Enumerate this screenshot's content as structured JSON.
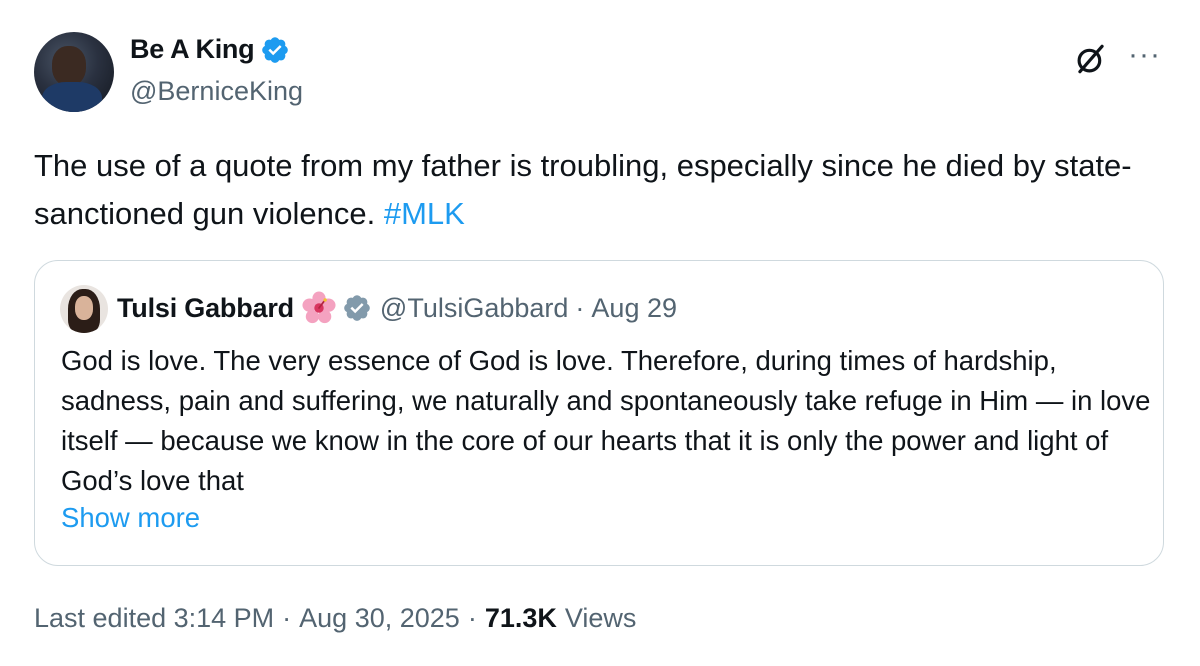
{
  "author": {
    "name": "Be A King",
    "handle": "@BerniceKing",
    "verified": true
  },
  "tweet": {
    "text": "The use of a quote from my father is troubling, especially since he died by state-sanctioned gun violence. ",
    "hashtag": "#MLK"
  },
  "quoted": {
    "name": "Tulsi Gabbard",
    "handle": "@TulsiGabbard",
    "separator": "·",
    "date": "Aug 29",
    "text": "God is love. The very essence of God is love. Therefore, during times of hardship, sadness, pain and suffering, we naturally and spontaneously take refuge in Him — in love itself — because we know in the core of our hearts that it is only the power and light of God’s love that",
    "show_more": "Show more"
  },
  "meta": {
    "edited": "Last edited 3:14 PM",
    "separator": "·",
    "date": "Aug 30, 2025",
    "views_count": "71.3K",
    "views_label": "Views"
  },
  "icons": {
    "verified": "verified-badge-icon",
    "grok": "grok-icon",
    "more": "more-horizontal-icon",
    "hibiscus": "hibiscus-emoji-icon"
  },
  "colors": {
    "accent": "#1d9bf0",
    "text": "#0f1419",
    "secondary": "#536471",
    "border": "#cfd9de",
    "gray_badge": "#829aab"
  }
}
